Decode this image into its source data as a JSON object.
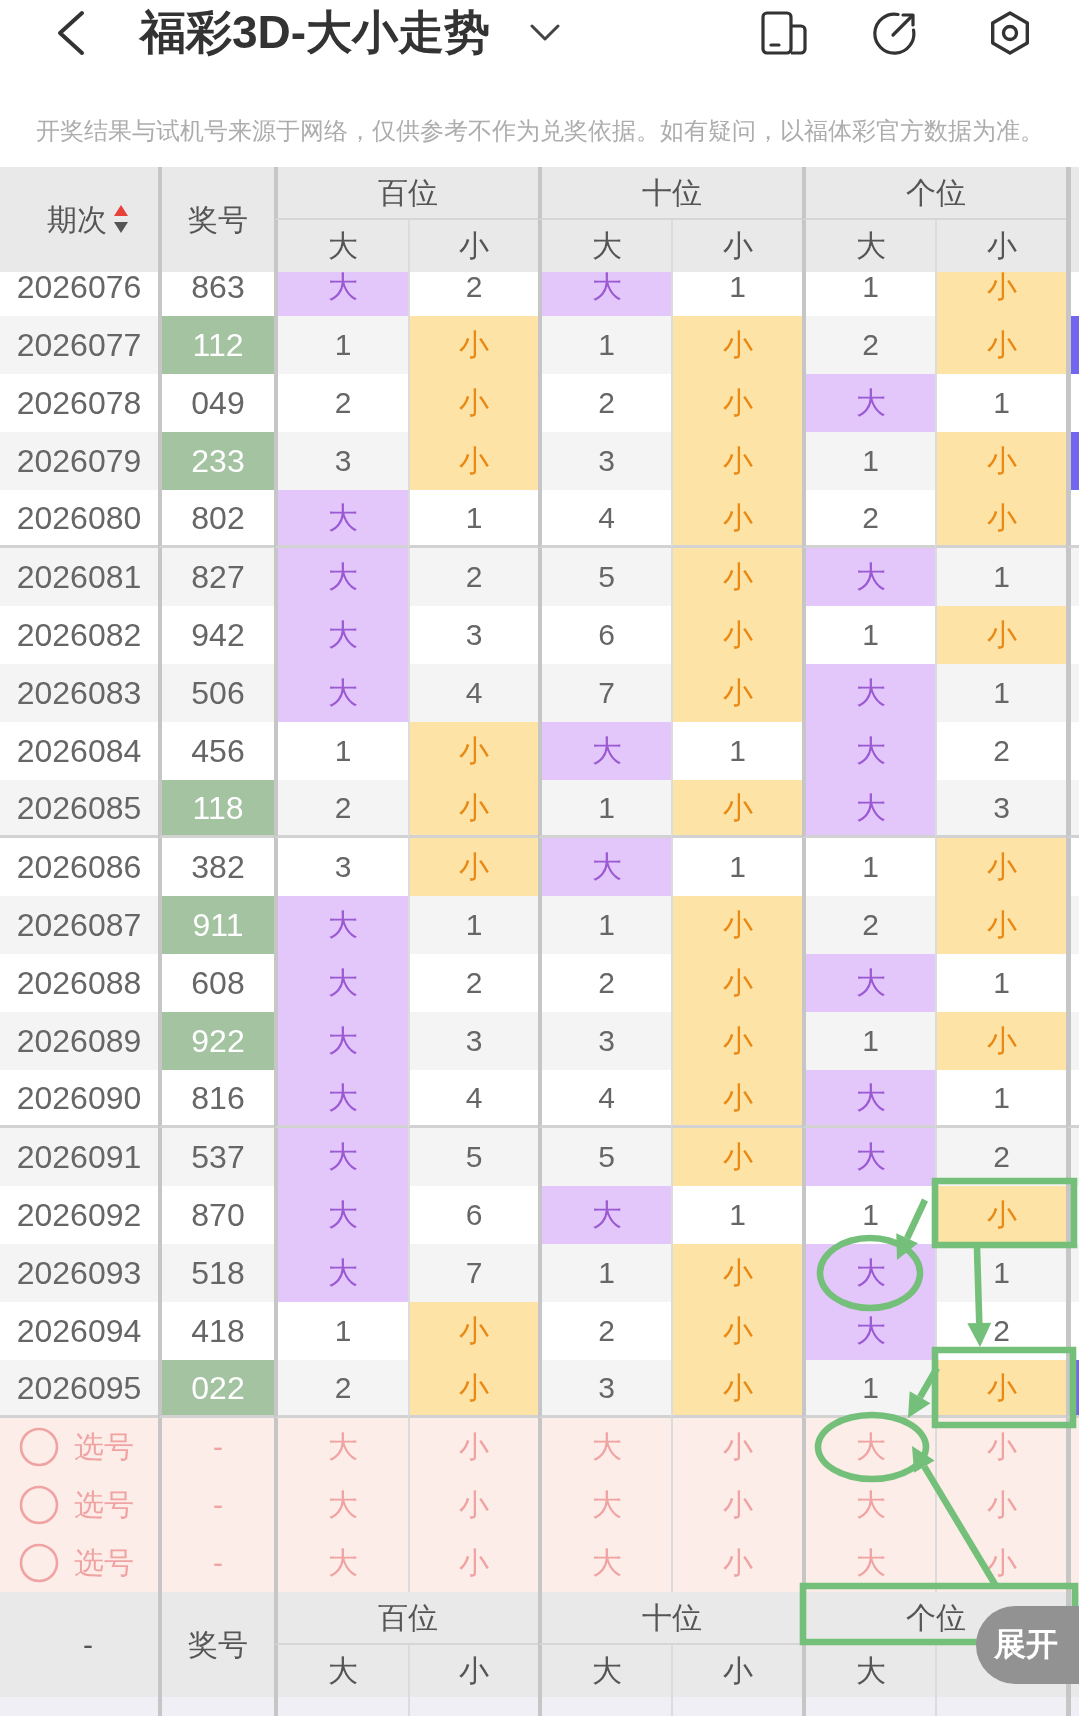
{
  "top_bar": {
    "title": "福彩3D-大小走势"
  },
  "notice": "开奖结果与试机号来源于网络，仅供参考不作为兑奖依据。如有疑问，以福体彩官方数据为准。",
  "table": {
    "header": {
      "period": "期次",
      "sort_ascending": true,
      "number": "奖号",
      "groups": [
        {
          "label": "百位",
          "columns": [
            "大",
            "小"
          ]
        },
        {
          "label": "十位",
          "columns": [
            "大",
            "小"
          ]
        },
        {
          "label": "个位",
          "columns": [
            "大",
            "小"
          ]
        }
      ]
    },
    "rows": [
      {
        "period": "2026076",
        "number": "863",
        "highlighted": false,
        "cells": [
          {
            "text": "大",
            "hit": true
          },
          {
            "text": "2",
            "hit": false
          },
          {
            "text": "大",
            "hit": true
          },
          {
            "text": "1",
            "hit": false
          },
          {
            "text": "1",
            "hit": false
          },
          {
            "text": "小",
            "hit": true
          }
        ],
        "edge_hit": false
      },
      {
        "period": "2026077",
        "number": "112",
        "highlighted": true,
        "cells": [
          {
            "text": "1",
            "hit": false
          },
          {
            "text": "小",
            "hit": true
          },
          {
            "text": "1",
            "hit": false
          },
          {
            "text": "小",
            "hit": true
          },
          {
            "text": "2",
            "hit": false
          },
          {
            "text": "小",
            "hit": true
          }
        ],
        "edge_hit": true
      },
      {
        "period": "2026078",
        "number": "049",
        "highlighted": false,
        "cells": [
          {
            "text": "2",
            "hit": false
          },
          {
            "text": "小",
            "hit": true
          },
          {
            "text": "2",
            "hit": false
          },
          {
            "text": "小",
            "hit": true
          },
          {
            "text": "大",
            "hit": true
          },
          {
            "text": "1",
            "hit": false
          }
        ],
        "edge_hit": false
      },
      {
        "period": "2026079",
        "number": "233",
        "highlighted": true,
        "cells": [
          {
            "text": "3",
            "hit": false
          },
          {
            "text": "小",
            "hit": true
          },
          {
            "text": "3",
            "hit": false
          },
          {
            "text": "小",
            "hit": true
          },
          {
            "text": "1",
            "hit": false
          },
          {
            "text": "小",
            "hit": true
          }
        ],
        "edge_hit": true
      },
      {
        "period": "2026080",
        "number": "802",
        "highlighted": false,
        "cells": [
          {
            "text": "大",
            "hit": true
          },
          {
            "text": "1",
            "hit": false
          },
          {
            "text": "4",
            "hit": false
          },
          {
            "text": "小",
            "hit": true
          },
          {
            "text": "2",
            "hit": false
          },
          {
            "text": "小",
            "hit": true
          }
        ],
        "edge_hit": false
      },
      {
        "period": "2026081",
        "number": "827",
        "highlighted": false,
        "cells": [
          {
            "text": "大",
            "hit": true
          },
          {
            "text": "2",
            "hit": false
          },
          {
            "text": "5",
            "hit": false
          },
          {
            "text": "小",
            "hit": true
          },
          {
            "text": "大",
            "hit": true
          },
          {
            "text": "1",
            "hit": false
          }
        ],
        "edge_hit": false
      },
      {
        "period": "2026082",
        "number": "942",
        "highlighted": false,
        "cells": [
          {
            "text": "大",
            "hit": true
          },
          {
            "text": "3",
            "hit": false
          },
          {
            "text": "6",
            "hit": false
          },
          {
            "text": "小",
            "hit": true
          },
          {
            "text": "1",
            "hit": false
          },
          {
            "text": "小",
            "hit": true
          }
        ],
        "edge_hit": false
      },
      {
        "period": "2026083",
        "number": "506",
        "highlighted": false,
        "cells": [
          {
            "text": "大",
            "hit": true
          },
          {
            "text": "4",
            "hit": false
          },
          {
            "text": "7",
            "hit": false
          },
          {
            "text": "小",
            "hit": true
          },
          {
            "text": "大",
            "hit": true
          },
          {
            "text": "1",
            "hit": false
          }
        ],
        "edge_hit": false
      },
      {
        "period": "2026084",
        "number": "456",
        "highlighted": false,
        "cells": [
          {
            "text": "1",
            "hit": false
          },
          {
            "text": "小",
            "hit": true
          },
          {
            "text": "大",
            "hit": true
          },
          {
            "text": "1",
            "hit": false
          },
          {
            "text": "大",
            "hit": true
          },
          {
            "text": "2",
            "hit": false
          }
        ],
        "edge_hit": false
      },
      {
        "period": "2026085",
        "number": "118",
        "highlighted": true,
        "cells": [
          {
            "text": "2",
            "hit": false
          },
          {
            "text": "小",
            "hit": true
          },
          {
            "text": "1",
            "hit": false
          },
          {
            "text": "小",
            "hit": true
          },
          {
            "text": "大",
            "hit": true
          },
          {
            "text": "3",
            "hit": false
          }
        ],
        "edge_hit": false
      },
      {
        "period": "2026086",
        "number": "382",
        "highlighted": false,
        "cells": [
          {
            "text": "3",
            "hit": false
          },
          {
            "text": "小",
            "hit": true
          },
          {
            "text": "大",
            "hit": true
          },
          {
            "text": "1",
            "hit": false
          },
          {
            "text": "1",
            "hit": false
          },
          {
            "text": "小",
            "hit": true
          }
        ],
        "edge_hit": false
      },
      {
        "period": "2026087",
        "number": "911",
        "highlighted": true,
        "cells": [
          {
            "text": "大",
            "hit": true
          },
          {
            "text": "1",
            "hit": false
          },
          {
            "text": "1",
            "hit": false
          },
          {
            "text": "小",
            "hit": true
          },
          {
            "text": "2",
            "hit": false
          },
          {
            "text": "小",
            "hit": true
          }
        ],
        "edge_hit": false
      },
      {
        "period": "2026088",
        "number": "608",
        "highlighted": false,
        "cells": [
          {
            "text": "大",
            "hit": true
          },
          {
            "text": "2",
            "hit": false
          },
          {
            "text": "2",
            "hit": false
          },
          {
            "text": "小",
            "hit": true
          },
          {
            "text": "大",
            "hit": true
          },
          {
            "text": "1",
            "hit": false
          }
        ],
        "edge_hit": false
      },
      {
        "period": "2026089",
        "number": "922",
        "highlighted": true,
        "cells": [
          {
            "text": "大",
            "hit": true
          },
          {
            "text": "3",
            "hit": false
          },
          {
            "text": "3",
            "hit": false
          },
          {
            "text": "小",
            "hit": true
          },
          {
            "text": "1",
            "hit": false
          },
          {
            "text": "小",
            "hit": true
          }
        ],
        "edge_hit": false
      },
      {
        "period": "2026090",
        "number": "816",
        "highlighted": false,
        "cells": [
          {
            "text": "大",
            "hit": true
          },
          {
            "text": "4",
            "hit": false
          },
          {
            "text": "4",
            "hit": false
          },
          {
            "text": "小",
            "hit": true
          },
          {
            "text": "大",
            "hit": true
          },
          {
            "text": "1",
            "hit": false
          }
        ],
        "edge_hit": false
      },
      {
        "period": "2026091",
        "number": "537",
        "highlighted": false,
        "cells": [
          {
            "text": "大",
            "hit": true
          },
          {
            "text": "5",
            "hit": false
          },
          {
            "text": "5",
            "hit": false
          },
          {
            "text": "小",
            "hit": true
          },
          {
            "text": "大",
            "hit": true
          },
          {
            "text": "2",
            "hit": false
          }
        ],
        "edge_hit": false
      },
      {
        "period": "2026092",
        "number": "870",
        "highlighted": false,
        "cells": [
          {
            "text": "大",
            "hit": true
          },
          {
            "text": "6",
            "hit": false
          },
          {
            "text": "大",
            "hit": true
          },
          {
            "text": "1",
            "hit": false
          },
          {
            "text": "1",
            "hit": false
          },
          {
            "text": "小",
            "hit": true
          }
        ],
        "edge_hit": false
      },
      {
        "period": "2026093",
        "number": "518",
        "highlighted": false,
        "cells": [
          {
            "text": "大",
            "hit": true
          },
          {
            "text": "7",
            "hit": false
          },
          {
            "text": "1",
            "hit": false
          },
          {
            "text": "小",
            "hit": true
          },
          {
            "text": "大",
            "hit": true
          },
          {
            "text": "1",
            "hit": false
          }
        ],
        "edge_hit": false
      },
      {
        "period": "2026094",
        "number": "418",
        "highlighted": false,
        "cells": [
          {
            "text": "1",
            "hit": false
          },
          {
            "text": "小",
            "hit": true
          },
          {
            "text": "2",
            "hit": false
          },
          {
            "text": "小",
            "hit": true
          },
          {
            "text": "大",
            "hit": true
          },
          {
            "text": "2",
            "hit": false
          }
        ],
        "edge_hit": false
      },
      {
        "period": "2026095",
        "number": "022",
        "highlighted": true,
        "cells": [
          {
            "text": "2",
            "hit": false
          },
          {
            "text": "小",
            "hit": true
          },
          {
            "text": "3",
            "hit": false
          },
          {
            "text": "小",
            "hit": true
          },
          {
            "text": "1",
            "hit": false
          },
          {
            "text": "小",
            "hit": true
          }
        ],
        "edge_hit": true
      }
    ],
    "pick_rows": [
      {
        "selected": false,
        "label": "选号",
        "number": "-",
        "options": [
          "大",
          "小",
          "大",
          "小",
          "大",
          "小"
        ]
      },
      {
        "selected": false,
        "label": "选号",
        "number": "-",
        "options": [
          "大",
          "小",
          "大",
          "小",
          "大",
          "小"
        ]
      },
      {
        "selected": false,
        "label": "选号",
        "number": "-",
        "options": [
          "大",
          "小",
          "大",
          "小",
          "大",
          "小"
        ]
      }
    ],
    "footer_header": {
      "period": "-",
      "number": "奖号",
      "groups": [
        {
          "label": "百位",
          "columns": [
            "大",
            "小"
          ]
        },
        {
          "label": "十位",
          "columns": [
            "大",
            "小"
          ]
        },
        {
          "label": "个位",
          "columns": [
            "大"
          ]
        }
      ]
    }
  },
  "expand_button": "展开",
  "markup": [
    {
      "kind": "box"
    },
    {
      "kind": "arrow"
    },
    {
      "kind": "ring"
    },
    {
      "kind": "arrow"
    },
    {
      "kind": "box"
    },
    {
      "kind": "arrow"
    },
    {
      "kind": "ring"
    },
    {
      "kind": "box"
    },
    {
      "kind": "arrow"
    }
  ]
}
